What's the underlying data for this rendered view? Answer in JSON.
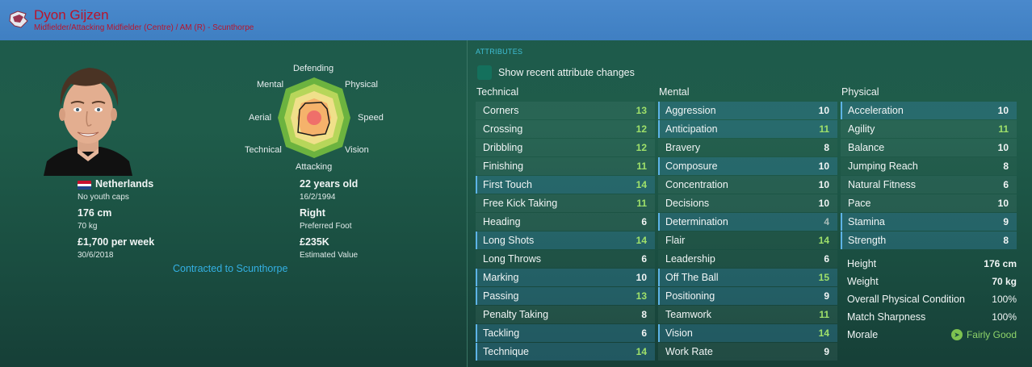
{
  "header": {
    "name": "Dyon Gijzen",
    "position": "Midfielder/Attacking Midfielder (Centre) / AM (R) - Scunthorpe"
  },
  "profile": {
    "nationality": "Netherlands",
    "youth_caps": "No youth caps",
    "height": "176 cm",
    "weight": "70 kg",
    "wage": "£1,700 per week",
    "contract_end": "30/6/2018",
    "age": "22 years old",
    "dob": "16/2/1994",
    "foot": "Right",
    "foot_label": "Preferred Foot",
    "value": "£235K",
    "value_label": "Estimated Value",
    "contract_status": "Contracted to Scunthorpe"
  },
  "radar": {
    "labels": {
      "defending": "Defending",
      "physical": "Physical",
      "speed": "Speed",
      "vision": "Vision",
      "attacking": "Attacking",
      "technical": "Technical",
      "aerial": "Aerial",
      "mental": "Mental"
    },
    "colors": [
      "#6cb33f",
      "#b7d65a",
      "#f0e08a",
      "#f5b26b",
      "#ef6f6a"
    ]
  },
  "attributes": {
    "title": "ATTRIBUTES",
    "show_changes": "Show recent attribute changes",
    "columns": {
      "technical": "Technical",
      "mental": "Mental",
      "physical": "Physical"
    },
    "technical": [
      {
        "name": "Corners",
        "value": "13"
      },
      {
        "name": "Crossing",
        "value": "12"
      },
      {
        "name": "Dribbling",
        "value": "12"
      },
      {
        "name": "Finishing",
        "value": "11"
      },
      {
        "name": "First Touch",
        "value": "14"
      },
      {
        "name": "Free Kick Taking",
        "value": "11"
      },
      {
        "name": "Heading",
        "value": "6"
      },
      {
        "name": "Long Shots",
        "value": "14"
      },
      {
        "name": "Long Throws",
        "value": "6"
      },
      {
        "name": "Marking",
        "value": "10"
      },
      {
        "name": "Passing",
        "value": "13"
      },
      {
        "name": "Penalty Taking",
        "value": "8"
      },
      {
        "name": "Tackling",
        "value": "6"
      },
      {
        "name": "Technique",
        "value": "14"
      }
    ],
    "mental": [
      {
        "name": "Aggression",
        "value": "10"
      },
      {
        "name": "Anticipation",
        "value": "11"
      },
      {
        "name": "Bravery",
        "value": "8"
      },
      {
        "name": "Composure",
        "value": "10"
      },
      {
        "name": "Concentration",
        "value": "10"
      },
      {
        "name": "Decisions",
        "value": "10"
      },
      {
        "name": "Determination",
        "value": "4"
      },
      {
        "name": "Flair",
        "value": "14"
      },
      {
        "name": "Leadership",
        "value": "6"
      },
      {
        "name": "Off The Ball",
        "value": "15"
      },
      {
        "name": "Positioning",
        "value": "9"
      },
      {
        "name": "Teamwork",
        "value": "11"
      },
      {
        "name": "Vision",
        "value": "14"
      },
      {
        "name": "Work Rate",
        "value": "9"
      }
    ],
    "physical": [
      {
        "name": "Acceleration",
        "value": "10"
      },
      {
        "name": "Agility",
        "value": "11"
      },
      {
        "name": "Balance",
        "value": "10"
      },
      {
        "name": "Jumping Reach",
        "value": "8"
      },
      {
        "name": "Natural Fitness",
        "value": "6"
      },
      {
        "name": "Pace",
        "value": "10"
      },
      {
        "name": "Stamina",
        "value": "9"
      },
      {
        "name": "Strength",
        "value": "8"
      }
    ]
  },
  "physical_info": {
    "height_label": "Height",
    "height": "176 cm",
    "weight_label": "Weight",
    "weight": "70 kg",
    "condition_label": "Overall Physical Condition",
    "condition": "100%",
    "sharpness_label": "Match Sharpness",
    "sharpness": "100%",
    "morale_label": "Morale",
    "morale": "Fairly Good"
  }
}
